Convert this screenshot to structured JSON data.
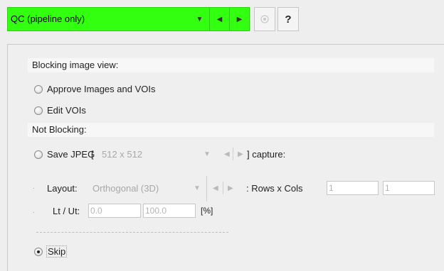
{
  "toolbar": {
    "mode_selected": "QC (pipeline only)",
    "colors": {
      "mode_bg": "#33ff11"
    },
    "icons": [
      "dropdown-arrow-icon",
      "prev-arrow-icon",
      "next-arrow-icon",
      "target-icon",
      "help-icon"
    ],
    "help_label": "?"
  },
  "blocking": {
    "title": "Blocking image view:",
    "options": [
      "Approve Images and VOIs",
      "Edit VOIs"
    ]
  },
  "not_blocking": {
    "title": "Not Blocking:",
    "save_jpeg_label": "Save JPEG",
    "bracket_open": "[",
    "resolution": "512 x 512",
    "capture_suffix": "] capture:",
    "layout_label": "Layout:",
    "layout_value": "Orthogonal (3D)",
    "rows_cols_label": ": Rows x Cols",
    "rows_value": "1",
    "cols_value": "1",
    "ltut_label": "Lt / Ut:",
    "lt_value": "0.0",
    "ut_value": "100.0",
    "percent_label": "[%]"
  },
  "skip": {
    "label": "Skip",
    "checked": true
  }
}
